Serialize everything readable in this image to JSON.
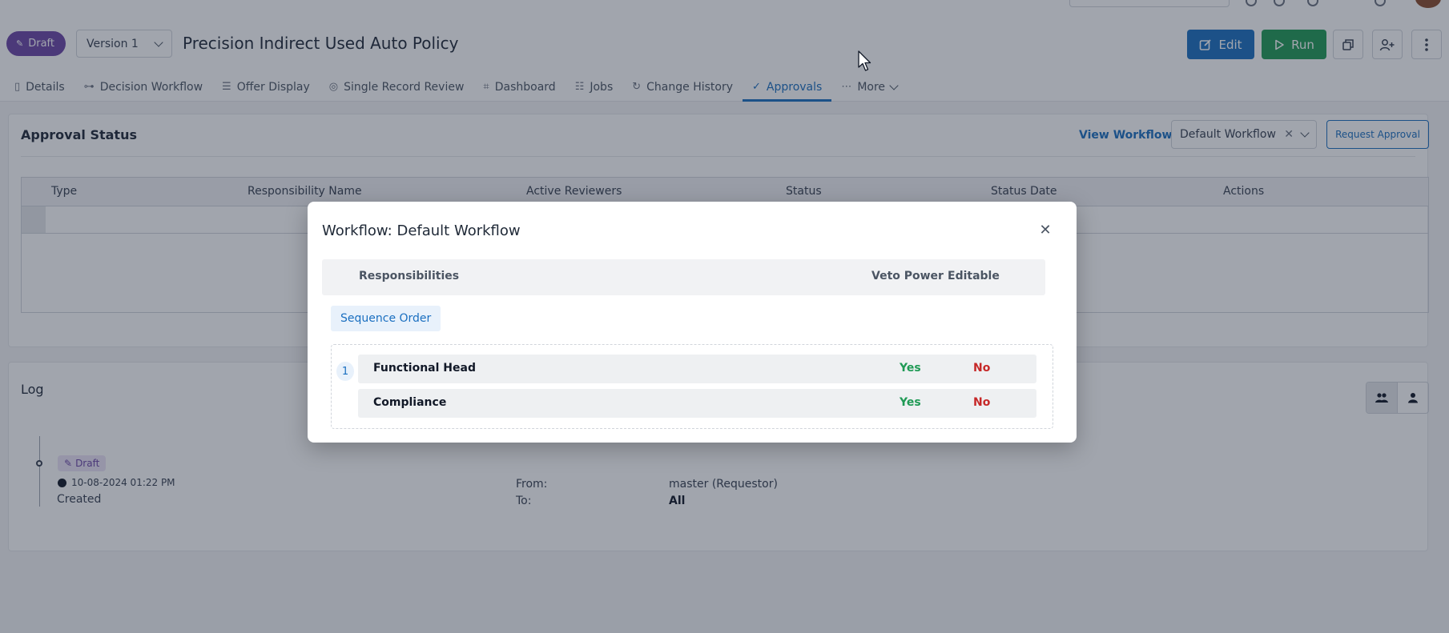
{
  "header": {
    "status_badge": "Draft",
    "version": "Version 1",
    "title": "Precision Indirect Used Auto Policy",
    "edit_label": "Edit",
    "run_label": "Run"
  },
  "tabs": [
    {
      "label": "Details",
      "icon": "document-icon"
    },
    {
      "label": "Decision Workflow",
      "icon": "workflow-icon"
    },
    {
      "label": "Offer Display",
      "icon": "offer-icon"
    },
    {
      "label": "Single Record Review",
      "icon": "record-icon"
    },
    {
      "label": "Dashboard",
      "icon": "chart-icon"
    },
    {
      "label": "Jobs",
      "icon": "jobs-icon"
    },
    {
      "label": "Change History",
      "icon": "history-icon"
    },
    {
      "label": "Approvals",
      "icon": "check-circle-icon",
      "active": true
    },
    {
      "label": "More",
      "icon": "more-icon"
    }
  ],
  "approval": {
    "title": "Approval Status",
    "view_workflow": "View Workflow",
    "workflow_select": "Default Workflow",
    "request_approval": "Request Approval",
    "columns": [
      "Type",
      "Responsibility Name",
      "Active Reviewers",
      "Status",
      "Status Date",
      "Actions"
    ]
  },
  "log": {
    "title": "Log",
    "entry": {
      "status": "Draft",
      "timestamp": "10-08-2024 01:22 PM",
      "action": "Created",
      "from_label": "From:",
      "from_value": "master (Requestor)",
      "to_label": "To:",
      "to_value": "All"
    }
  },
  "modal": {
    "title": "Workflow: Default Workflow",
    "columns": {
      "responsibilities": "Responsibilities",
      "veto": "Veto Power",
      "editable": "Editable"
    },
    "sequence_label": "Sequence Order",
    "sequence_number": "1",
    "rows": [
      {
        "name": "Functional Head",
        "veto": "Yes",
        "editable": "No"
      },
      {
        "name": "Compliance",
        "veto": "Yes",
        "editable": "No"
      }
    ]
  },
  "colors": {
    "primary": "#1a6fc0",
    "run_green": "#1f9a55",
    "draft_purple": "#6b46a6",
    "no_red": "#c62828"
  }
}
